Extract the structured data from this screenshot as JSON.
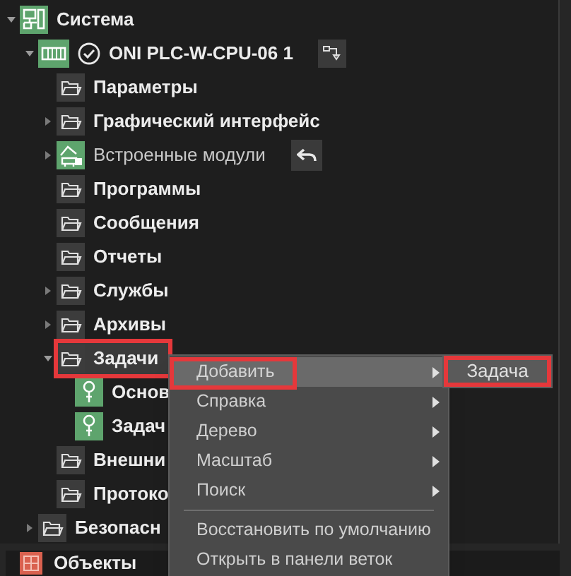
{
  "tree": {
    "label": "Система",
    "kind": "system",
    "expanded": true,
    "children": [
      {
        "label": "ONI PLC-W-CPU-06 1",
        "kind": "plc",
        "expanded": true,
        "checked": true,
        "action": {
          "kind": "goto"
        },
        "children": [
          {
            "label": "Параметры",
            "kind": "folder"
          },
          {
            "label": "Графический интерфейс",
            "kind": "folder",
            "expanded": false
          },
          {
            "label": "Встроенные модули",
            "kind": "module",
            "expanded": false,
            "action": {
              "kind": "undo"
            }
          },
          {
            "label": "Программы",
            "kind": "folder"
          },
          {
            "label": "Сообщения",
            "kind": "folder"
          },
          {
            "label": "Отчеты",
            "kind": "folder"
          },
          {
            "label": "Службы",
            "kind": "folder",
            "expanded": false
          },
          {
            "label": "Архивы",
            "kind": "folder",
            "expanded": false
          },
          {
            "label": "Задачи",
            "kind": "folder",
            "expanded": true,
            "highlighted": true,
            "children": [
              {
                "label": "Основ",
                "kind": "task"
              },
              {
                "label": "Задач",
                "kind": "task"
              }
            ]
          },
          {
            "label": "Внешни",
            "kind": "folder"
          },
          {
            "label": "Протоко",
            "kind": "folder"
          }
        ]
      },
      {
        "label": "Безопасн",
        "kind": "folder",
        "expanded": false
      }
    ]
  },
  "bottom_panel": {
    "label": "Объекты"
  },
  "context_menu": {
    "items": [
      {
        "kind": "item",
        "label": "Добавить",
        "submenu": true,
        "selected": true,
        "highlighted": true
      },
      {
        "kind": "item",
        "label": "Справка",
        "submenu": true,
        "selected": false,
        "highlighted": false
      },
      {
        "kind": "item",
        "label": "Дерево",
        "submenu": true,
        "selected": false,
        "highlighted": false
      },
      {
        "kind": "item",
        "label": "Масштаб",
        "submenu": true,
        "selected": false,
        "highlighted": false
      },
      {
        "kind": "item",
        "label": "Поиск",
        "submenu": true,
        "selected": false,
        "highlighted": false
      },
      {
        "kind": "separator"
      },
      {
        "kind": "item",
        "label": "Восстановить по умолчанию",
        "submenu": false,
        "selected": false,
        "highlighted": false
      },
      {
        "kind": "item",
        "label": "Открыть в панели веток",
        "submenu": false,
        "selected": false,
        "highlighted": false
      }
    ]
  },
  "submenu": {
    "items": [
      {
        "label": "Задача",
        "highlighted": true
      }
    ]
  }
}
